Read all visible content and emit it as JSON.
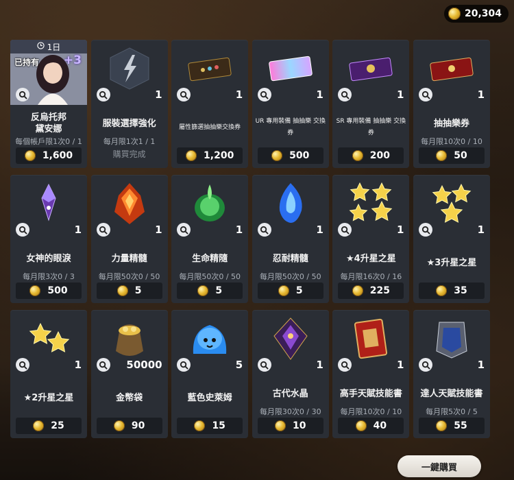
{
  "currency": {
    "amount": "20,304",
    "icon": "gold-coin-icon"
  },
  "buy_all_label": "一鍵購買",
  "items": [
    {
      "name": "反烏托邦\n黛安娜",
      "qty": "",
      "limit": "每個帳戶限1次0 / 1",
      "price": "1,600",
      "timer": "1日",
      "owned": "已持有",
      "plus": "+3",
      "art": "character-portrait"
    },
    {
      "name": "服裝選擇強化",
      "qty": "1",
      "limit": "每月限1次1 / 1",
      "status": "購買完成",
      "art": "lightning"
    },
    {
      "name": "屬性篩選抽抽樂交換券",
      "qty": "1",
      "price": "1,200",
      "small": true,
      "art": "ticket-dark"
    },
    {
      "name": "UR 專用裝備 抽抽樂 交換券",
      "qty": "1",
      "price": "500",
      "small": true,
      "art": "ticket-rainbow"
    },
    {
      "name": "SR 專用裝備 抽抽樂 交換券",
      "qty": "1",
      "price": "200",
      "small": true,
      "art": "ticket-purple"
    },
    {
      "name": "抽抽樂券",
      "qty": "1",
      "limit": "每月限10次0 / 10",
      "price": "50",
      "art": "ticket-red"
    },
    {
      "name": "女神的眼淚",
      "qty": "1",
      "limit": "每月限3次0 / 3",
      "price": "500",
      "art": "purple-gem"
    },
    {
      "name": "力量精髓",
      "qty": "1",
      "limit": "每月限50次0 / 50",
      "price": "5",
      "art": "red-crystal"
    },
    {
      "name": "生命精隨",
      "qty": "1",
      "limit": "每月限50次0 / 50",
      "price": "5",
      "art": "green-crystal"
    },
    {
      "name": "忍耐精髓",
      "qty": "1",
      "limit": "每月限50次0 / 50",
      "price": "5",
      "art": "blue-crystal"
    },
    {
      "name": "★4升星之星",
      "qty": "1",
      "limit": "每月限16次0 / 16",
      "price": "225",
      "art": "stars-4"
    },
    {
      "name": "★3升星之星",
      "qty": "1",
      "price": "35",
      "art": "stars-3"
    },
    {
      "name": "★2升星之星",
      "qty": "1",
      "price": "25",
      "art": "stars-2"
    },
    {
      "name": "金幣袋",
      "qty": "50000",
      "price": "90",
      "art": "gold-bag"
    },
    {
      "name": "藍色史萊姆",
      "qty": "5",
      "price": "15",
      "art": "blue-slime"
    },
    {
      "name": "古代水晶",
      "qty": "1",
      "limit": "每月限30次0 / 30",
      "price": "10",
      "art": "ancient-crystal"
    },
    {
      "name": "高手天賦技能書",
      "qty": "1",
      "limit": "每月限10次0 / 10",
      "price": "40",
      "art": "red-book"
    },
    {
      "name": "達人天賦技能書",
      "qty": "1",
      "limit": "每月限5次0 / 5",
      "price": "55",
      "art": "armor-book"
    }
  ]
}
